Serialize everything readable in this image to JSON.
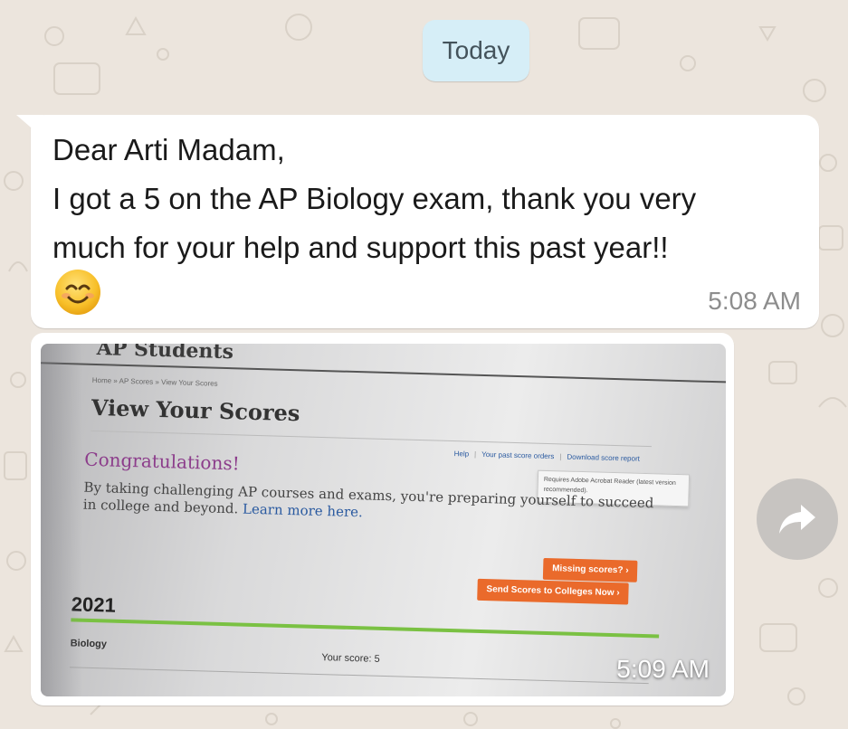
{
  "chat": {
    "date_chip": "Today",
    "message_text": {
      "lines": [
        "Dear Arti Madam,",
        "I got a 5 on the AP Biology exam, thank you very",
        "much for your help and support this past year!!"
      ],
      "emoji": "smiling-face-with-smiling-eyes",
      "time": "5:08 AM"
    },
    "message_photo": {
      "time": "5:09 AM",
      "screenshot": {
        "header": "AP Students",
        "breadcrumb": "Home » AP Scores » View Your Scores",
        "title": "View Your Scores",
        "links": [
          "Help",
          "Your past score orders",
          "Download score report"
        ],
        "tooltip": "Requires Adobe Acrobat Reader (latest version recommended).",
        "congrats_heading": "Congratulations!",
        "congrats_body": "By taking challenging AP courses and exams, you're preparing yourself to succeed in college and beyond.",
        "learn_more": "Learn more here.",
        "missing_button": "Missing scores? ›",
        "send_button": "Send Scores to Colleges Now ›",
        "year": "2021",
        "subject": "Biology",
        "score_text": "Your score: 5"
      }
    }
  },
  "colors": {
    "wallpaper": "#ece5dd",
    "date_chip_bg": "#d6eef7",
    "bubble_bg": "#ffffff",
    "time_gray": "#8d8d8d",
    "ap_orange": "#ea6a2b",
    "ap_purple": "#8c3d8b",
    "ap_green": "#7ac143"
  },
  "icons": {
    "forward": "forward-arrow-icon"
  }
}
